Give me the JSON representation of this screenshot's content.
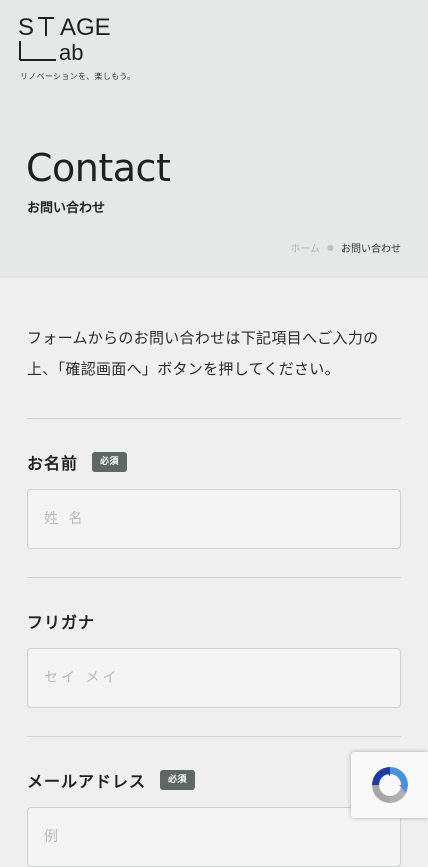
{
  "header": {
    "logo_text": "STAGE Lab",
    "tagline": "リノベーションを、楽しもう。"
  },
  "hero": {
    "title": "Contact",
    "subtitle": "お問い合わせ"
  },
  "breadcrumb": {
    "home": "ホーム",
    "current": "お問い合わせ"
  },
  "intro": {
    "text": "フォームからのお問い合わせは下記項目へご入力の上、「確認画面へ」ボタンを押してください。"
  },
  "form": {
    "name": {
      "label": "お名前",
      "badge": "必須",
      "placeholder": "姓 名",
      "value": ""
    },
    "furigana": {
      "label": "フリガナ",
      "placeholder": "セイ メイ",
      "value": ""
    },
    "email": {
      "label": "メールアドレス",
      "badge": "必須",
      "placeholder": "例",
      "value": ""
    }
  },
  "colors": {
    "hero_bg": "#e6e8e7",
    "page_bg": "#eeefee",
    "badge_bg": "#5f6764",
    "recaptcha_blue": "#4a90e2"
  },
  "icons": {
    "recaptcha": "recaptcha-icon"
  }
}
